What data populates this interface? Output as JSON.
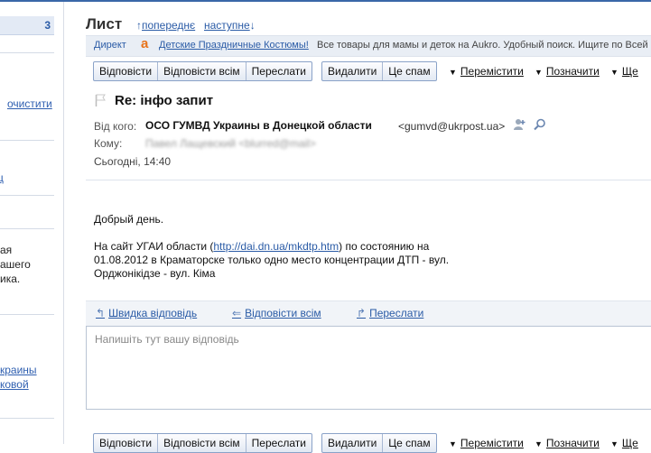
{
  "sidebar": {
    "count": "3",
    "clear_link": "очистити",
    "link_fragment": "ц",
    "text_lines": [
      "ая",
      "ашего",
      "ика."
    ],
    "link_lines": [
      "краины",
      "ковой"
    ]
  },
  "header": {
    "title": "Лист",
    "prev_label": "попереднє",
    "next_label": "наступне"
  },
  "ad": {
    "label": "Директ",
    "link": "Детские Праздничные Костюмы!",
    "text": "Все товары для мамы и деток на Aukro. Удобный поиск. Ищите по Всей"
  },
  "toolbar": {
    "reply": "Відповісти",
    "reply_all": "Відповісти всім",
    "forward": "Переслати",
    "delete": "Видалити",
    "spam": "Це спам",
    "move": "Перемістити",
    "mark": "Позначити",
    "more": "Ще"
  },
  "message": {
    "subject": "Re: інфо запит",
    "from_label": "Від кого:",
    "from_name": "ОСО ГУМВД Украины в Донецкой области",
    "from_email": "<gumvd@ukrpost.ua>",
    "to_label": "Кому:",
    "to_value": "Павел Лащевский <blurred@mail>",
    "date": "Сьогодні, 14:40",
    "greeting": "Добрый день.",
    "body_prefix": "На сайт УГАИ области (",
    "body_link": "http://dai.dn.ua/mkdtp.htm",
    "body_suffix": ") по состоянию на",
    "body_line2": "01.08.2012 в Краматорске только одно место концентрации ДТП - вул.",
    "body_line3": "Орджонікідзе - вул. Кіма"
  },
  "reply": {
    "quick": "Швидка відповідь",
    "reply_all": "Відповісти всім",
    "forward": "Переслати",
    "placeholder": "Напишіть тут вашу відповідь"
  },
  "colors": {
    "accent": "#2a5ba6",
    "toolbar_border": "#8aa2c8",
    "ad_bg": "#e9eef5"
  }
}
